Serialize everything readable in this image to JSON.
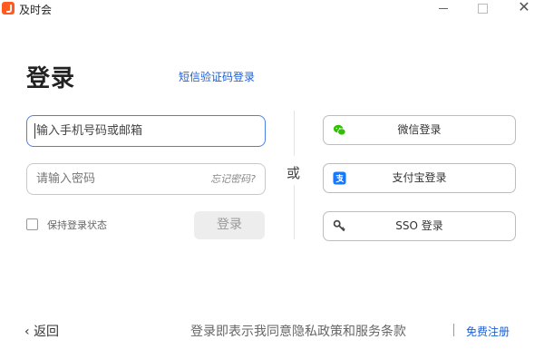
{
  "window": {
    "title": "及时会",
    "controls": {
      "minimize_icon": "minimize-icon",
      "maximize_icon": "maximize-icon",
      "close_icon": "close-icon"
    }
  },
  "login": {
    "title": "登录",
    "sms_login_link": "短信验证码登录",
    "phone_placeholder": "输入手机号码或邮箱",
    "password_placeholder": "请输入密码",
    "forgot_password": "忘记密码?",
    "keep_logged_in": "保持登录状态",
    "login_button": "登录",
    "login_button_enabled": false
  },
  "divider": {
    "or_text": "或"
  },
  "alternatives": [
    {
      "icon": "wechat-icon",
      "label": "微信登录",
      "color": "#2dc100"
    },
    {
      "icon": "alipay-icon",
      "label": "支付宝登录",
      "color": "#1677ff"
    },
    {
      "icon": "key-icon",
      "label": "SSO 登录",
      "color": "#444444"
    }
  ],
  "footer": {
    "back": "返回",
    "terms": "登录即表示我同意隐私政策和服务条款",
    "register": "免费注册"
  },
  "colors": {
    "brand": "#ff5a1f",
    "link": "#1a5fd6",
    "focus_border": "#4b80e8"
  }
}
